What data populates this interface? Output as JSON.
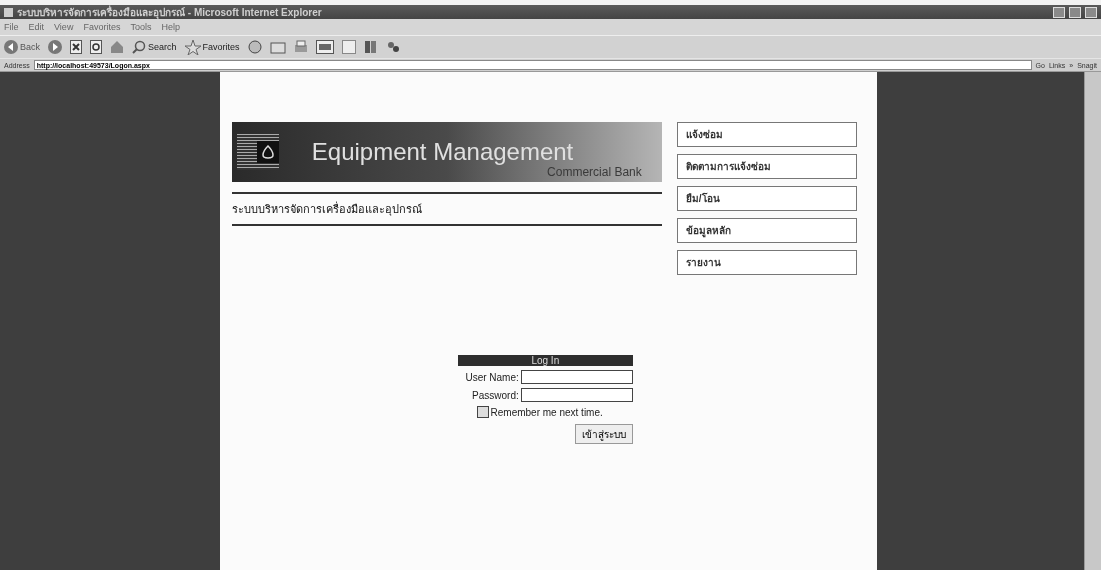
{
  "window": {
    "title": "ระบบบริหารจัดการเครื่องมือและอุปกรณ์ - Microsoft Internet Explorer"
  },
  "menu_bar": [
    "File",
    "Edit",
    "View",
    "Favorites",
    "Tools",
    "Help"
  ],
  "toolbar": {
    "back": "Back",
    "search": "Search",
    "favorites": "Favorites"
  },
  "address_bar": {
    "label": "Address",
    "url": "http://localhost:49573/Logon.aspx",
    "go": "Go",
    "links": "Links",
    "more": "»",
    "snagit": "Snagit"
  },
  "banner": {
    "title": "Equipment Management",
    "subtitle": "Commercial Bank"
  },
  "system_name": "ระบบบริหารจัดการเครื่องมือและอุปกรณ์",
  "nav_menu": [
    "แจ้งซ่อม",
    "ติดตามการแจ้งซ่อม",
    "ยืม/โอน",
    "ข้อมูลหลัก",
    "รายงาน"
  ],
  "login": {
    "title": "Log In",
    "user_label": "User Name:",
    "password_label": "Password:",
    "remember": {
      "label": "Remember me next time.",
      "checked": false
    },
    "submit": "เข้าสู่ระบบ"
  }
}
